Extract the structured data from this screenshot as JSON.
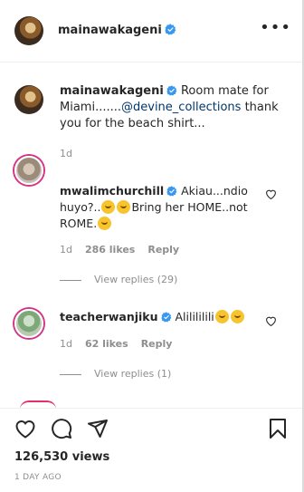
{
  "header": {
    "username": "mainawakageni",
    "verified": true,
    "more_icon": "more-horizontal-icon"
  },
  "caption": {
    "username": "mainawakageni",
    "text_before": " Room mate for Miami.......",
    "mention": "@devine_collections",
    "text_after": " thank you for the beach shirt...",
    "timestamp": "1d"
  },
  "comments": [
    {
      "username": "mwalimchurchill",
      "text_a": " Akiau...ndio huyo?..",
      "text_b": "Bring her HOME..not ROME.",
      "time": "1d",
      "likes": "286 likes",
      "reply": "Reply",
      "view_replies": "View replies (29)"
    },
    {
      "username": "teacherwanjiku",
      "text_a": " Alilililili",
      "time": "1d",
      "likes": "62 likes",
      "reply": "Reply",
      "view_replies": "View replies (1)"
    }
  ],
  "actions": {
    "views": "126,530 views",
    "date": "1 DAY AGO"
  },
  "colors": {
    "verified": "#3897f0",
    "mention": "#00376b",
    "secondary_text": "#8e8e8e",
    "story_ring": "#d63384"
  }
}
